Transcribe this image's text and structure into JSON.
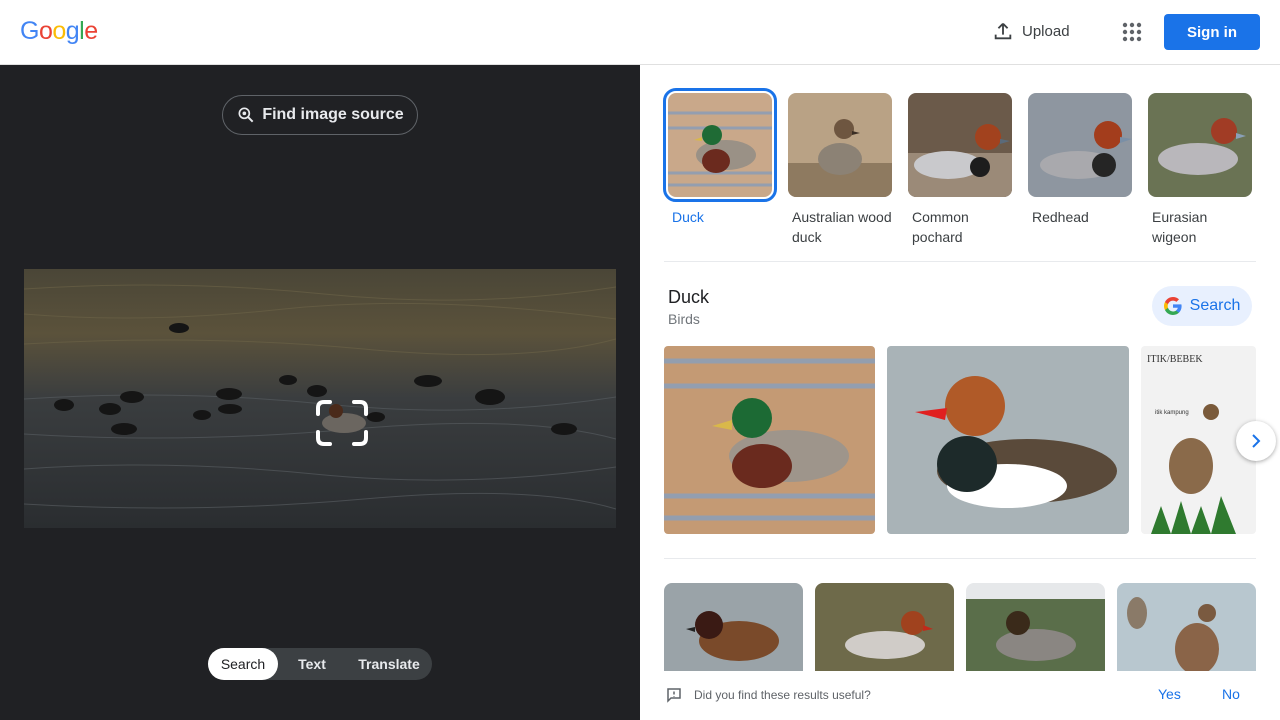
{
  "header": {
    "logo_letters": [
      "G",
      "o",
      "o",
      "g",
      "l",
      "e"
    ],
    "logo_colors": [
      "#4285f4",
      "#ea4335",
      "#fbbc05",
      "#4285f4",
      "#34a853",
      "#ea4335"
    ],
    "upload_label": "Upload",
    "signin_label": "Sign in",
    "upload_icon": "upload-icon",
    "apps_icon": "apps-grid-icon"
  },
  "left": {
    "find_source_label": "Find image source",
    "modes": [
      {
        "label": "Search",
        "active": true
      },
      {
        "label": "Text",
        "active": false
      },
      {
        "label": "Translate",
        "active": false
      }
    ]
  },
  "right": {
    "entities": [
      {
        "label": "Duck",
        "selected": true
      },
      {
        "label": "Australian wood duck",
        "selected": false
      },
      {
        "label": "Common pochard",
        "selected": false
      },
      {
        "label": "Redhead",
        "selected": false
      },
      {
        "label": "Eurasian wigeon",
        "selected": false
      }
    ],
    "knowledge": {
      "title": "Duck",
      "subtitle": "Birds",
      "search_label": "Search"
    },
    "gallery_text": "ITIK/BEBEK",
    "gallery_small_text": "itik kampung",
    "feedback": {
      "question": "Did you find these results useful?",
      "yes": "Yes",
      "no": "No"
    }
  },
  "colors": {
    "accent": "#1a73e8",
    "dark_panel": "#202124"
  }
}
